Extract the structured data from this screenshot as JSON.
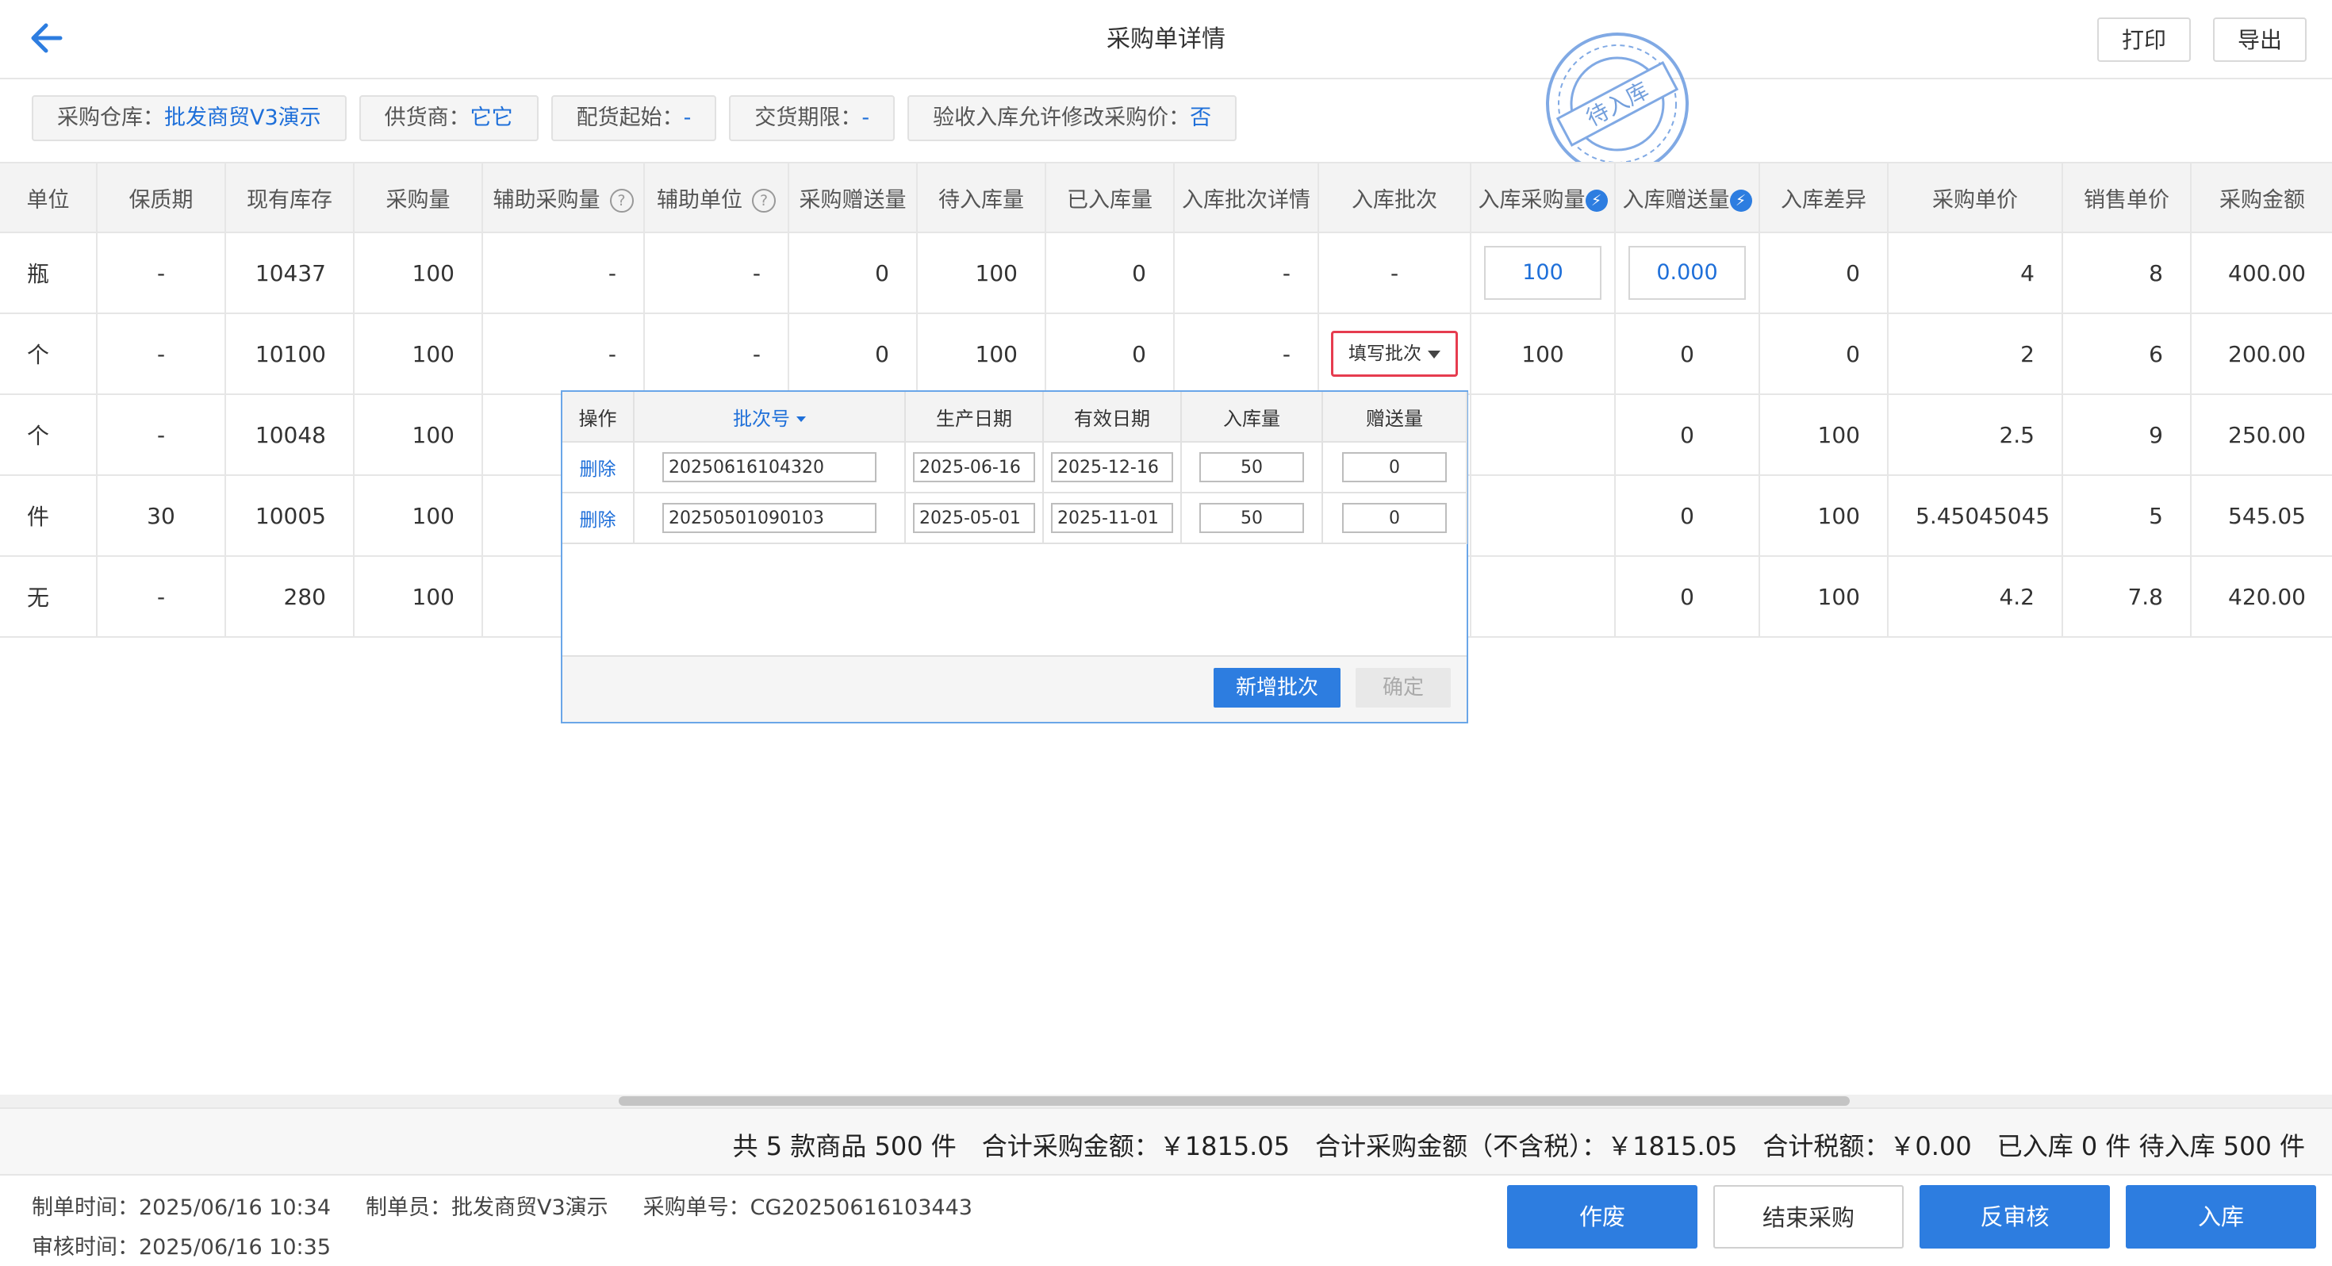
{
  "header": {
    "title": "采购单详情",
    "print": "打印",
    "export": "导出"
  },
  "info": [
    {
      "label": "采购仓库：",
      "value": "批发商贸V3演示"
    },
    {
      "label": "供货商：",
      "value": "它它"
    },
    {
      "label": "配货起始：",
      "value": "-"
    },
    {
      "label": "交货期限：",
      "value": "-"
    },
    {
      "label": "验收入库允许修改采购价：",
      "value": "否"
    }
  ],
  "stamp": {
    "text": "待入库",
    "color": "#5b8fd6"
  },
  "table": {
    "columns": [
      "单位",
      "保质期",
      "现有库存",
      "采购量",
      "辅助采购量",
      "辅助单位",
      "采购赠送量",
      "待入库量",
      "已入库量",
      "入库批次详情",
      "入库批次",
      "入库采购量",
      "入库赠送量",
      "入库差异",
      "采购单价",
      "销售单价",
      "采购金额"
    ],
    "rows": [
      [
        "瓶",
        "-",
        "10437",
        "100",
        "-",
        "-",
        "0",
        "100",
        "0",
        "-",
        "-",
        "100",
        "0.000",
        "0",
        "4",
        "8",
        "400.00"
      ],
      [
        "个",
        "-",
        "10100",
        "100",
        "-",
        "-",
        "0",
        "100",
        "0",
        "-",
        "填写批次",
        "100",
        "0",
        "0",
        "2",
        "6",
        "200.00"
      ],
      [
        "个",
        "-",
        "10048",
        "100",
        "",
        "",
        "",
        "",
        "",
        "",
        "",
        "",
        "0",
        "100",
        "2.5",
        "9",
        "250.00"
      ],
      [
        "件",
        "30",
        "10005",
        "100",
        "",
        "",
        "",
        "",
        "",
        "",
        "",
        "",
        "0",
        "100",
        "5.45045045",
        "5",
        "545.05"
      ],
      [
        "无",
        "-",
        "280",
        "100",
        "",
        "",
        "",
        "",
        "",
        "",
        "",
        "",
        "0",
        "100",
        "4.2",
        "7.8",
        "420.00"
      ]
    ]
  },
  "batch_popup": {
    "headers": [
      "操作",
      "批次号",
      "生产日期",
      "有效日期",
      "入库量",
      "赠送量"
    ],
    "rows": [
      {
        "op": "删除",
        "batch": "20250616104320",
        "prod": "2025-06-16",
        "exp": "2025-12-16",
        "qty": "50",
        "gift": "0"
      },
      {
        "op": "删除",
        "batch": "20250501090103",
        "prod": "2025-05-01",
        "exp": "2025-11-01",
        "qty": "50",
        "gift": "0"
      }
    ],
    "add": "新增批次",
    "confirm": "确定"
  },
  "totals": {
    "count": "共 5 款商品 500 件",
    "amount": "合计采购金额：￥1815.05",
    "amount_notax": "合计采购金额（不含税）：￥1815.05",
    "tax": "合计税额：￥0.00",
    "status": "已入库 0 件 待入库 500 件"
  },
  "footer": {
    "create_time": "制单时间：2025/06/16 10:34",
    "creator": "制单员：批发商贸V3演示",
    "order_no": "采购单号：CG20250616103443",
    "audit_time": "审核时间：2025/06/16 10:35",
    "buttons": {
      "void": "作废",
      "end": "结束采购",
      "unaudit": "反审核",
      "stock_in": "入库"
    }
  }
}
